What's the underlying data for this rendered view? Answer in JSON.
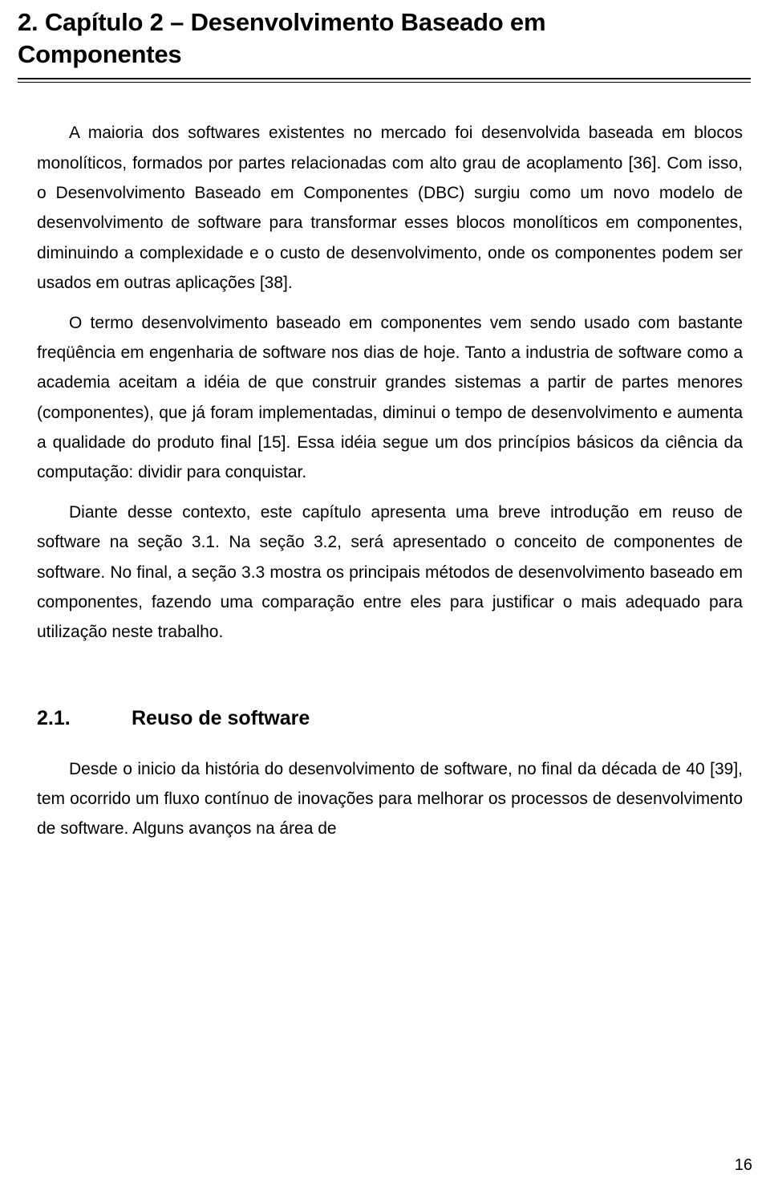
{
  "document": {
    "chapter_heading": "2. Capítulo 2 – Desenvolvimento Baseado em Componentes",
    "paragraphs": [
      "A maioria dos softwares existentes no mercado foi desenvolvida baseada em blocos monolíticos, formados por partes relacionadas com alto grau de acoplamento [36]. Com isso, o Desenvolvimento Baseado em Componentes (DBC) surgiu como um novo modelo de desenvolvimento de software para transformar esses blocos monolíticos em componentes, diminuindo a complexidade e o custo de desenvolvimento, onde os componentes podem ser usados em outras aplicações [38].",
      "O termo desenvolvimento baseado em componentes vem sendo usado com bastante freqüência em engenharia de software nos dias de hoje. Tanto a industria de software como a academia aceitam a idéia de que construir grandes sistemas a partir de partes menores (componentes), que já foram implementadas, diminui o tempo de desenvolvimento e aumenta a qualidade do produto final [15]. Essa idéia segue um dos princípios básicos da ciência da computação: dividir para conquistar.",
      "Diante desse contexto, este capítulo apresenta uma breve introdução em reuso de software na seção 3.1. Na seção 3.2, será apresentado o conceito de componentes de software. No final, a seção 3.3 mostra os principais métodos de desenvolvimento baseado em componentes, fazendo uma comparação entre eles para justificar o mais adequado para utilização neste trabalho."
    ],
    "section": {
      "number": "2.1.",
      "title": "Reuso de software",
      "paragraphs": [
        "Desde o inicio da história do desenvolvimento de software, no final da década de 40 [39], tem ocorrido um fluxo contínuo de inovações para melhorar os processos de desenvolvimento de software. Alguns avanços na área de"
      ]
    },
    "page_number": "16"
  }
}
